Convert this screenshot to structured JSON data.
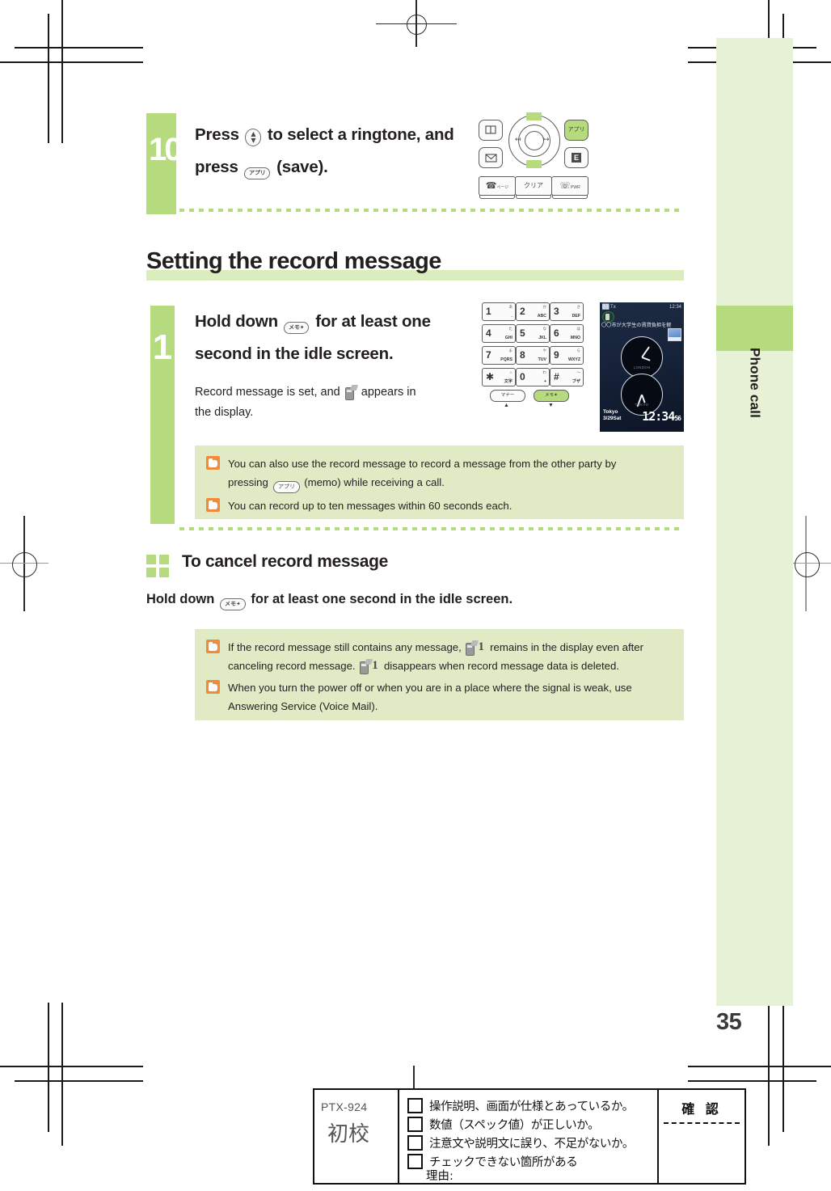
{
  "page": {
    "number": "35",
    "sidebar_label": "Phone call"
  },
  "step10": {
    "number": "10",
    "line1_a": "Press",
    "line1_key": "▲▼",
    "line1_b": "to select a ringtone, and",
    "line2_a": "press",
    "line2_key": "アプリ",
    "line2_b": "(save)."
  },
  "section": {
    "title": "Setting the record message"
  },
  "step1": {
    "number": "1",
    "head_a": "Hold down",
    "head_key": "メモ✦",
    "head_b": "for at least one",
    "head_line2": "second in the idle screen.",
    "body_a": "Record message is set, and",
    "body_b": "appears in",
    "body_line2": "the display."
  },
  "notes_step1": [
    {
      "icon": "pointing-hand-icon",
      "text_a": "You can also use the record message to record a message from the other party by",
      "text_b": "pressing",
      "key": "アプリ",
      "text_c": "(memo) while receiving a call."
    },
    {
      "icon": "pointing-hand-icon",
      "text_a": "You can record up to ten messages within 60 seconds each.",
      "text_b": "",
      "key": "",
      "text_c": ""
    }
  ],
  "subsection": {
    "title": "To cancel record message",
    "instruction_a": "Hold down",
    "instruction_key": "メモ✦",
    "instruction_b": "for at least one second in the idle screen."
  },
  "notes_cancel": [
    {
      "icon": "pointing-hand-icon",
      "text_a": "If the record message still contains any message,",
      "text_b": "remains in the display even after",
      "text_c": "canceling record message.",
      "text_d": "disappears when record message data is deleted."
    },
    {
      "icon": "pointing-hand-icon",
      "text_a": "When you turn the power off or when you are in a place where the signal is weak, use",
      "text_b": "Answering Service (Voice Mail).",
      "text_c": "",
      "text_d": ""
    }
  ],
  "nav_art": {
    "key_book": "Ὅ6",
    "key_mail": "✉",
    "key_app": "アプリ",
    "key_ez": "E",
    "key_call": "ページ",
    "key_clear": "クリア",
    "key_power": "PWR"
  },
  "keypad_art": {
    "keys": [
      {
        "num": "1",
        "sub": "あい",
        "alpha": "."
      },
      {
        "num": "2",
        "sub": "か",
        "alpha": "ABC"
      },
      {
        "num": "3",
        "sub": "さ",
        "alpha": "DEF"
      },
      {
        "num": "4",
        "sub": "た",
        "alpha": "GHI"
      },
      {
        "num": "5",
        "sub": "な",
        "alpha": "JKL"
      },
      {
        "num": "6",
        "sub": "は",
        "alpha": "MNO"
      },
      {
        "num": "7",
        "sub": "ま",
        "alpha": "PQRS"
      },
      {
        "num": "8",
        "sub": "や",
        "alpha": "TUV"
      },
      {
        "num": "9",
        "sub": "ら",
        "alpha": "WXYZ"
      },
      {
        "num": "∗",
        "sub": "文字",
        "alpha": ""
      },
      {
        "num": "0",
        "sub": "わをん",
        "alpha": "+"
      },
      {
        "num": "#",
        "sub": "ブザー",
        "alpha": ""
      }
    ],
    "soft_manner": "マナー",
    "soft_memo": "メモ✦",
    "arrow_up": "▲",
    "arrow_down": "▼"
  },
  "display_art": {
    "status_left": "██ Tx",
    "status_right": "12:34",
    "ticker": "〇〇市が大学生の賃貸負担を軽",
    "clock_top_name": "LONDON",
    "clock_bottom_name": "TOKYO",
    "city": "Tokyo",
    "date": "3/29Sat",
    "time": "12:34",
    "seconds": "56"
  },
  "proof_sheet": {
    "code": "PTX-924",
    "stage": "初校",
    "confirm": "確 認",
    "items": [
      "操作説明、画面が仕様とあっているか。",
      "数値（スペック値）が正しいか。",
      "注意文や説明文に誤り、不足がないか。",
      "チェックできない箇所がある"
    ],
    "reason_label": "理由:"
  },
  "colors": {
    "accent_green": "#b5db7e",
    "pale_green": "#e6f1d5",
    "note_green": "#e0ebc6",
    "heading_bar": "#dbecbd",
    "note_icon_orange": "#f08a3c",
    "text": "#231f20"
  }
}
